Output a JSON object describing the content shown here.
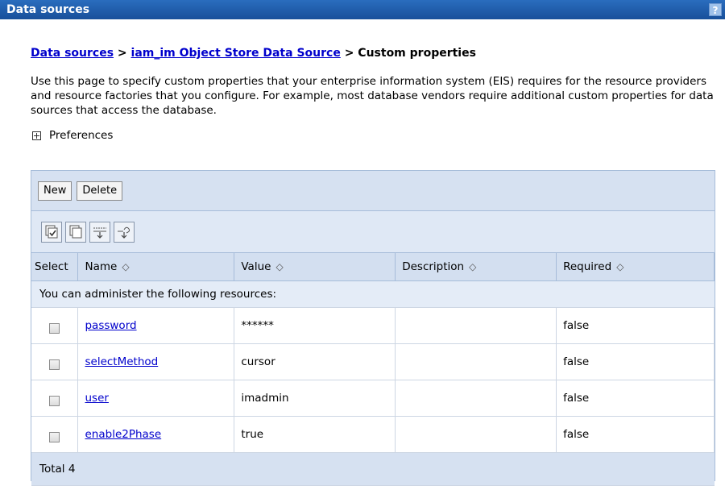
{
  "title_bar": {
    "title": "Data sources",
    "help_label": "?"
  },
  "breadcrumb": {
    "items": [
      "Data sources",
      "iam_im Object Store Data Source"
    ],
    "separator": ">",
    "current": "Custom properties"
  },
  "description": "Use this page to specify custom properties that your enterprise information system (EIS) requires for the resource providers and resource factories that you configure. For example, most database vendors require additional custom properties for data sources that access the database.",
  "preferences_label": "Preferences",
  "toolbar": {
    "new_label": "New",
    "delete_label": "Delete"
  },
  "icon_buttons": [
    "select-all-icon",
    "deselect-all-icon",
    "show-filter-icon",
    "clear-filter-icon"
  ],
  "table": {
    "columns": [
      "Select",
      "Name",
      "Value",
      "Description",
      "Required"
    ],
    "group_label": "You can administer the following resources:",
    "rows": [
      {
        "name": "password",
        "value": "******",
        "description": "",
        "required": "false"
      },
      {
        "name": "selectMethod",
        "value": "cursor",
        "description": "",
        "required": "false"
      },
      {
        "name": "user",
        "value": "imadmin",
        "description": "",
        "required": "false"
      },
      {
        "name": "enable2Phase",
        "value": "true",
        "description": "",
        "required": "false"
      }
    ],
    "total_label": "Total 4"
  },
  "colors": {
    "title_bar": "#1f5ba8",
    "link": "#0000cc",
    "toolbar_bg": "#d6e1f1",
    "header_bg": "#d3dff0"
  }
}
